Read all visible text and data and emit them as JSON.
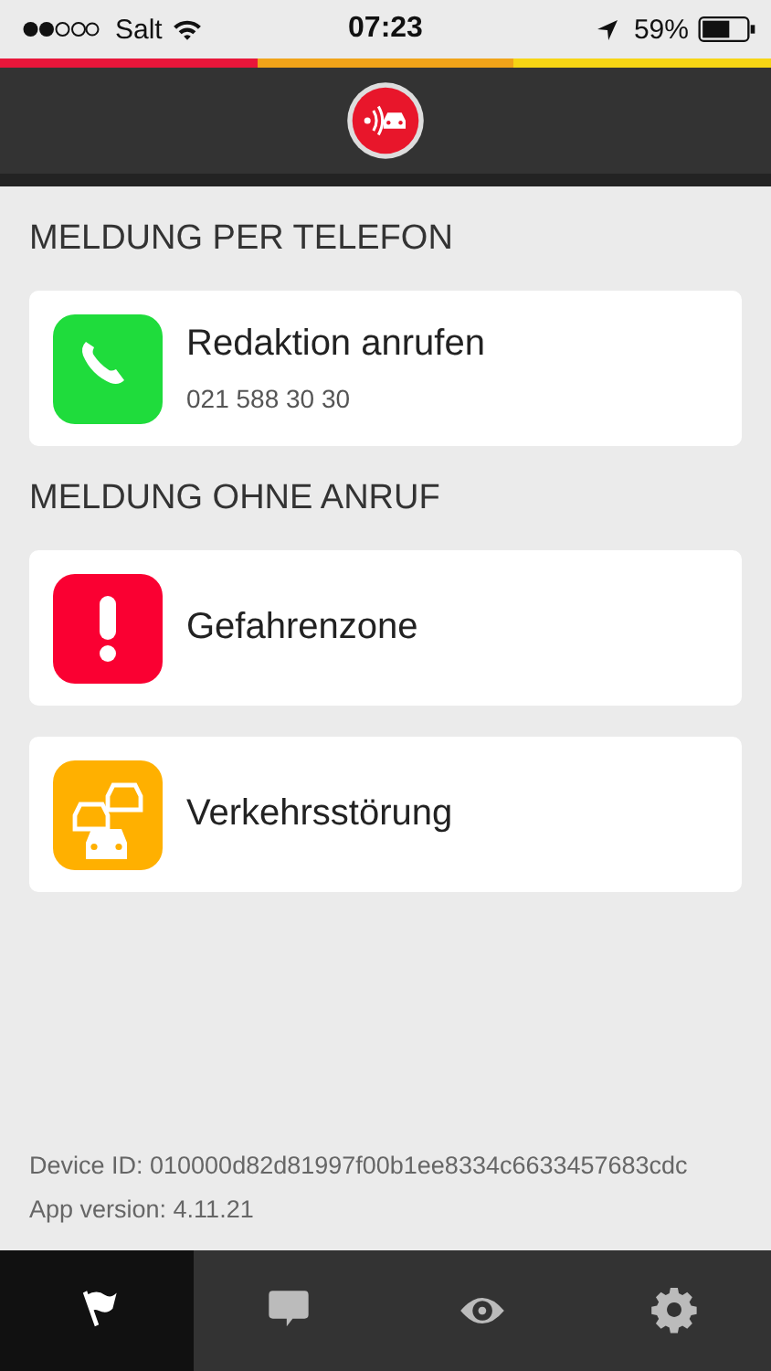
{
  "status_bar": {
    "carrier": "Salt",
    "time": "07:23",
    "battery": "59%"
  },
  "sections": [
    {
      "title": "MELDUNG PER TELEFON",
      "items": [
        {
          "kind": "phone",
          "color": "#1fdc3c",
          "label": "Redaktion anrufen",
          "detail": "021 588 30 30"
        }
      ]
    },
    {
      "title": "MELDUNG OHNE ANRUF",
      "items": [
        {
          "kind": "alert",
          "color": "#fa0032",
          "label": "Gefahrenzone"
        },
        {
          "kind": "traffic",
          "color": "#ffb000",
          "label": "Verkehrsstörung"
        }
      ]
    }
  ],
  "footer": [
    "Device ID: 010000d82d81997f00b1ee8334c6633457683cdc",
    "App version: 4.11.21"
  ],
  "tab_bar": [
    {
      "kind": "flag",
      "selected": true
    },
    {
      "kind": "chat",
      "selected": false
    },
    {
      "kind": "eye",
      "selected": false
    },
    {
      "kind": "gear",
      "selected": false
    }
  ]
}
